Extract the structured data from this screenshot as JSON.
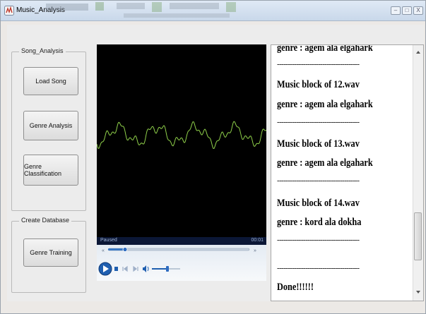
{
  "window": {
    "title": "Music_Analysis",
    "minimize_glyph": "–",
    "maximize_glyph": "□",
    "close_glyph": "X"
  },
  "song_analysis": {
    "label": "Song_Analysis",
    "load_song": "Load Song",
    "genre_analysis": "Genre Analysis",
    "genre_classification": "Genre Classification"
  },
  "create_database": {
    "label": "Create Database",
    "genre_training": "Genre Training"
  },
  "player": {
    "status": "Paused",
    "time": "00:01",
    "seek_progress": 0.12,
    "volume_level": 0.55
  },
  "output": {
    "lines": [
      {
        "type": "text",
        "text": "genre :   agem ala elgahark"
      },
      {
        "type": "sep"
      },
      {
        "type": "text",
        "text": "Music block of 12.wav"
      },
      {
        "type": "text",
        "text": "genre :   agem ala elgahark"
      },
      {
        "type": "sep"
      },
      {
        "type": "text",
        "text": "Music block of 13.wav"
      },
      {
        "type": "text",
        "text": "genre :   agem ala elgahark"
      },
      {
        "type": "sep"
      },
      {
        "type": "text",
        "text": "Music block of 14.wav"
      },
      {
        "type": "text",
        "text": "genre :   kord ala dokha"
      },
      {
        "type": "sep"
      },
      {
        "type": "sep"
      },
      {
        "type": "text",
        "text": "Done!!!!!!"
      }
    ],
    "separator": "--------------------------------------"
  },
  "colors": {
    "waveform": "#8fd04a",
    "play_button": "#1f5fb0"
  }
}
